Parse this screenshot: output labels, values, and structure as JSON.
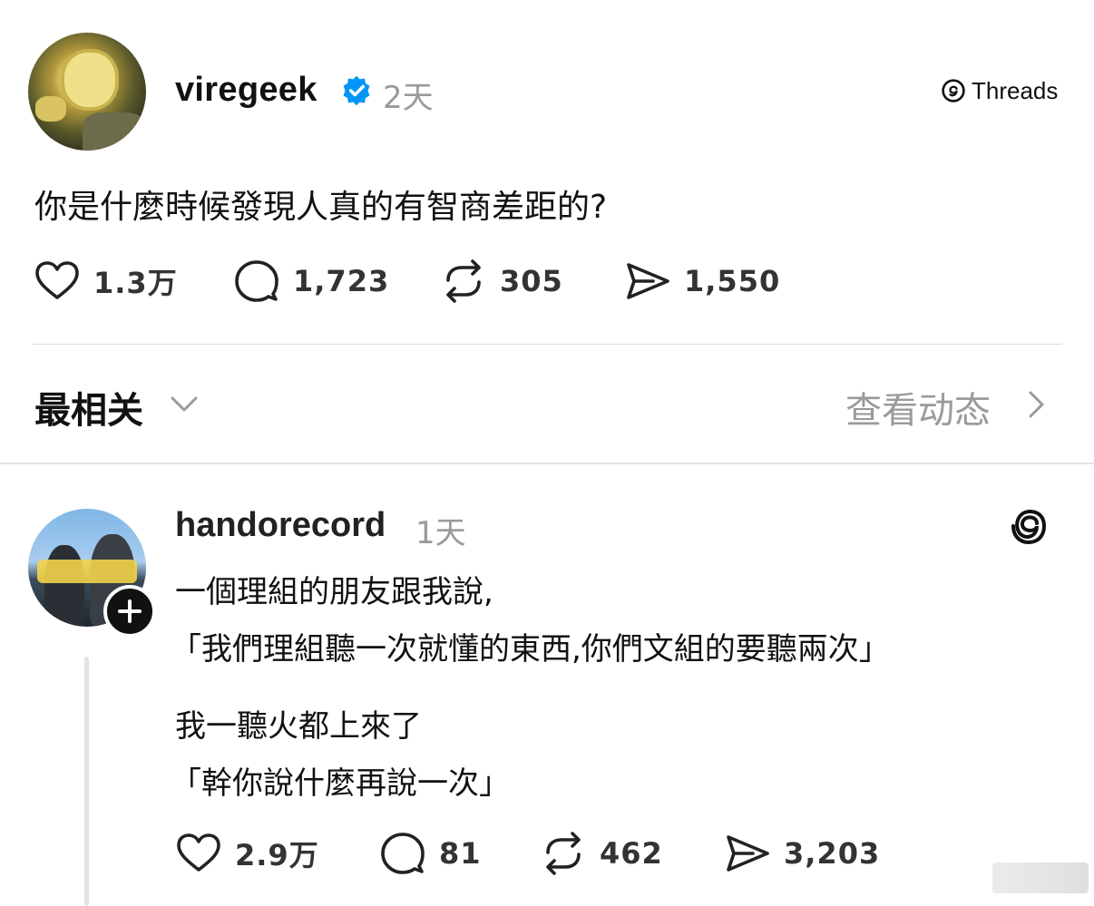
{
  "post": {
    "username": "viregeek",
    "timestamp": "2天",
    "threads_label": "Threads",
    "text": "你是什麼時候發現人真的有智商差距的?",
    "stats": {
      "likes": "1.3万",
      "comments": "1,723",
      "reposts": "305",
      "shares": "1,550"
    }
  },
  "sort": {
    "label": "最相关",
    "activity_link": "查看动态"
  },
  "reply": {
    "username": "handorecord",
    "timestamp": "1天",
    "lines": [
      "一個理組的朋友跟我說,",
      "「我們理組聽一次就懂的東西,你們文組的要聽兩次」",
      "我一聽火都上來了",
      "「幹你說什麼再說一次」"
    ],
    "stats": {
      "likes": "2.9万",
      "comments": "81",
      "reposts": "462",
      "shares": "3,203"
    }
  },
  "colors": {
    "verified_blue": "#0095f6",
    "muted_text": "#9a9a9a"
  },
  "icons": [
    "heart-icon",
    "comment-icon",
    "repost-icon",
    "share-icon",
    "verified-badge-icon",
    "threads-logo-icon",
    "chevron-down-icon",
    "chevron-right-icon",
    "plus-icon"
  ]
}
